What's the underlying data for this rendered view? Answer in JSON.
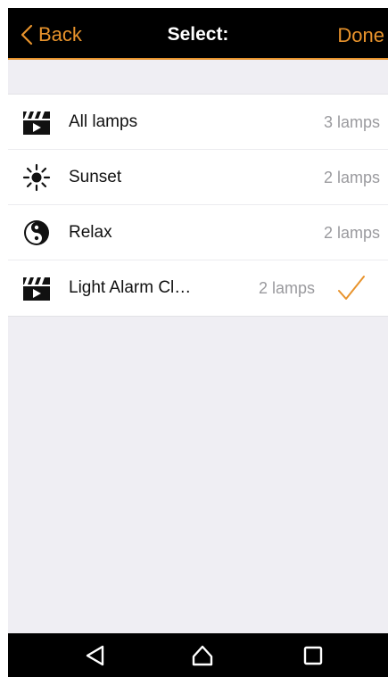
{
  "header": {
    "back_label": "Back",
    "title": "Select:",
    "done_label": "Done"
  },
  "scenes": [
    {
      "name": "All lamps",
      "count": "3 lamps",
      "icon": "clapperboard-icon",
      "selected": false
    },
    {
      "name": "Sunset",
      "count": "2 lamps",
      "icon": "sun-icon",
      "selected": false
    },
    {
      "name": "Relax",
      "count": "2 lamps",
      "icon": "yin-yang-icon",
      "selected": false
    },
    {
      "name": "Light Alarm Cl…",
      "count": "2 lamps",
      "icon": "clapperboard-icon",
      "selected": true
    }
  ],
  "navbar": {
    "icons": [
      "back-triangle-icon",
      "home-icon",
      "recents-square-icon"
    ]
  },
  "colors": {
    "accent": "#e8932c",
    "bar_background": "#000000",
    "page_background": "#efeef3",
    "secondary_text": "#9a9a9e"
  }
}
